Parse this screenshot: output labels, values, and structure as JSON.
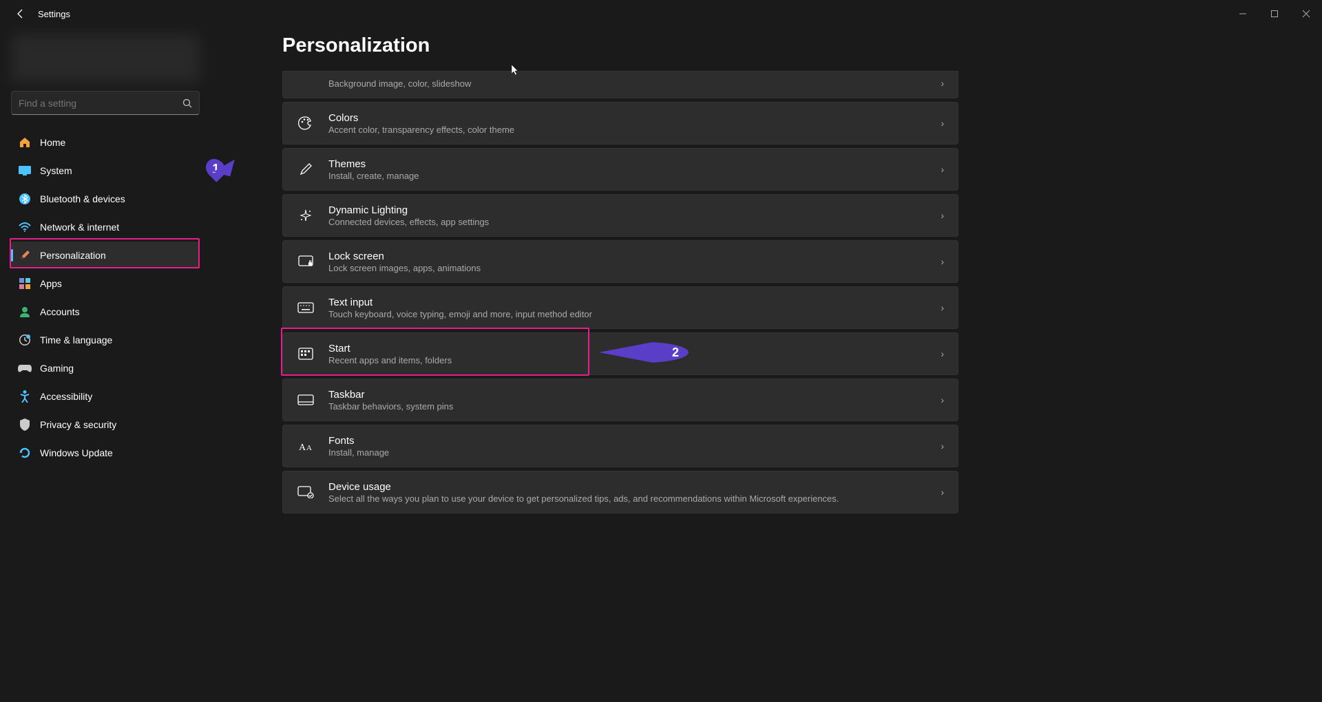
{
  "window": {
    "title": "Settings"
  },
  "search": {
    "placeholder": "Find a setting"
  },
  "nav": [
    {
      "icon": "home",
      "label": "Home",
      "color": "#f2a33c"
    },
    {
      "icon": "system",
      "label": "System",
      "color": "#4cc2ff"
    },
    {
      "icon": "bluetooth",
      "label": "Bluetooth & devices",
      "color": "#4cc2ff"
    },
    {
      "icon": "network",
      "label": "Network & internet",
      "color": "#4cc2ff"
    },
    {
      "icon": "personalization",
      "label": "Personalization",
      "color": "#e6875a"
    },
    {
      "icon": "apps",
      "label": "Apps",
      "color": "#7b8cde"
    },
    {
      "icon": "accounts",
      "label": "Accounts",
      "color": "#3cb371"
    },
    {
      "icon": "time",
      "label": "Time & language",
      "color": "#aaa"
    },
    {
      "icon": "gaming",
      "label": "Gaming",
      "color": "#aaa"
    },
    {
      "icon": "accessibility",
      "label": "Accessibility",
      "color": "#4cc2ff"
    },
    {
      "icon": "privacy",
      "label": "Privacy & security",
      "color": "#aaa"
    },
    {
      "icon": "update",
      "label": "Windows Update",
      "color": "#4cc2ff"
    }
  ],
  "page": {
    "title": "Personalization"
  },
  "cards_partial_sub": "Background image, color, slideshow",
  "cards": [
    {
      "title": "Colors",
      "sub": "Accent color, transparency effects, color theme",
      "icon": "palette"
    },
    {
      "title": "Themes",
      "sub": "Install, create, manage",
      "icon": "brush"
    },
    {
      "title": "Dynamic Lighting",
      "sub": "Connected devices, effects, app settings",
      "icon": "sparkle"
    },
    {
      "title": "Lock screen",
      "sub": "Lock screen images, apps, animations",
      "icon": "lockscreen"
    },
    {
      "title": "Text input",
      "sub": "Touch keyboard, voice typing, emoji and more, input method editor",
      "icon": "keyboard"
    },
    {
      "title": "Start",
      "sub": "Recent apps and items, folders",
      "icon": "start"
    },
    {
      "title": "Taskbar",
      "sub": "Taskbar behaviors, system pins",
      "icon": "taskbar"
    },
    {
      "title": "Fonts",
      "sub": "Install, manage",
      "icon": "fonts"
    },
    {
      "title": "Device usage",
      "sub": "Select all the ways you plan to use your device to get personalized tips, ads, and recommendations within Microsoft experiences.",
      "icon": "device"
    }
  ],
  "annotations": {
    "pin1": "1",
    "pin2": "2"
  }
}
